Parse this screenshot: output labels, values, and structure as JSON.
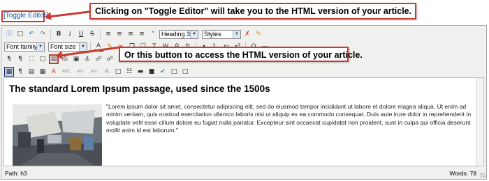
{
  "toggle_editor": {
    "label": "[Toggle Editor]"
  },
  "callouts": {
    "toggle": "Clicking on \"Toggle Editor\" will take you to the HTML version of your article.",
    "html_button": "Or this button to access the HTML version of your article."
  },
  "toolbar": {
    "bold": "B",
    "italic": "I",
    "underline": "U",
    "strike": "S",
    "format_select": "Heading 3",
    "styles_select": "Styles",
    "font_family_select": "Font family",
    "font_size_select": "Font size",
    "omega": "Ω",
    "subscript": "x₂",
    "superscript": "x²",
    "ltr": "¶",
    "pilcrow": "¶",
    "abc": "ABC",
    "abc_lower": "abc",
    "abc_small": "abc"
  },
  "content": {
    "heading": "The standard Lorem Ipsum passage, used since the 1500s",
    "paragraph": "\"Lorem ipsum dolor sit amet, consectetur adipiscing elit, sed do eiusmod tempor incididunt ut labore et dolore magna aliqua. Ut enim ad minim veniam, quis nostrud exercitation ullamco laboris nisi ut aliquip ex ea commodo consequat. Duis aute irure dolor in reprehenderit in voluptate velit esse cillum dolore eu fugiat nulla pariatur. Excepteur sint occaecat cupidatat non proident, sunt in culpa qui officia deserunt mollit anim id est laborum.\""
  },
  "status": {
    "path": "Path:  h3",
    "words": "Words: 78"
  },
  "colors": {
    "callout_border": "#c8392f",
    "link": "#1a4fa0",
    "toolbar_bg": "#f0f0ee"
  }
}
